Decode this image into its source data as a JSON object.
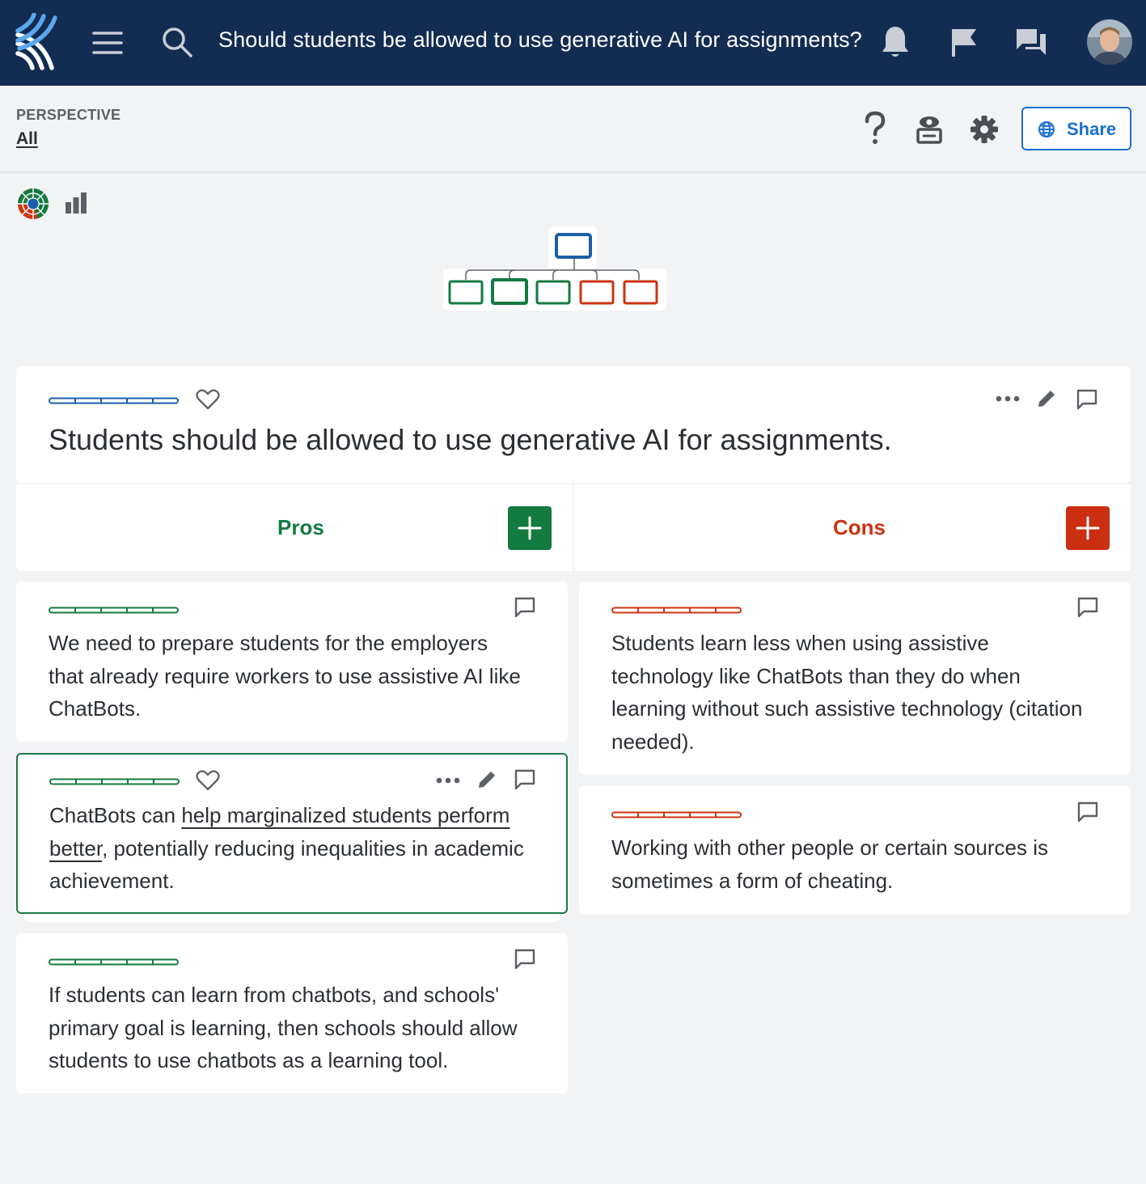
{
  "header": {
    "question": "Should students be allowed to use generative AI for assignments?",
    "icons": [
      "logo-icon",
      "menu-icon",
      "search-icon",
      "bell-icon",
      "flag-icon",
      "chat-icon",
      "avatar"
    ],
    "background": "#132c52"
  },
  "perspective": {
    "label": "PERSPECTIVE",
    "value": "All",
    "share_label": "Share",
    "icons": [
      "help-icon",
      "inbox-icon",
      "gear-icon",
      "globe-icon"
    ]
  },
  "view_icons": [
    "sunburst-icon",
    "bar-chart-icon",
    "tree-map"
  ],
  "thesis": {
    "text": "Students should be allowed to use generative AI for assignments."
  },
  "columns": {
    "pros_label": "Pros",
    "cons_label": "Cons",
    "pros_color": "#137a40",
    "cons_color": "#cc3311"
  },
  "pros": [
    {
      "text": "We need to prepare students for the employers that already require workers to use assistive AI like ChatBots."
    },
    {
      "text_before": "ChatBots can ",
      "link": "help marginalized students perform better",
      "text_after": ", potentially reducing inequalities in academic achievement."
    },
    {
      "text": "If students can learn from chatbots, and schools' primary goal is learning, then schools should allow students to use chatbots as a learning tool."
    }
  ],
  "cons": [
    {
      "text": "Students learn less when using assistive technology like ChatBots than they do when learning without such assistive technology (citation needed)."
    },
    {
      "text": "Working with other people or certain sources is sometimes a form of cheating."
    }
  ]
}
